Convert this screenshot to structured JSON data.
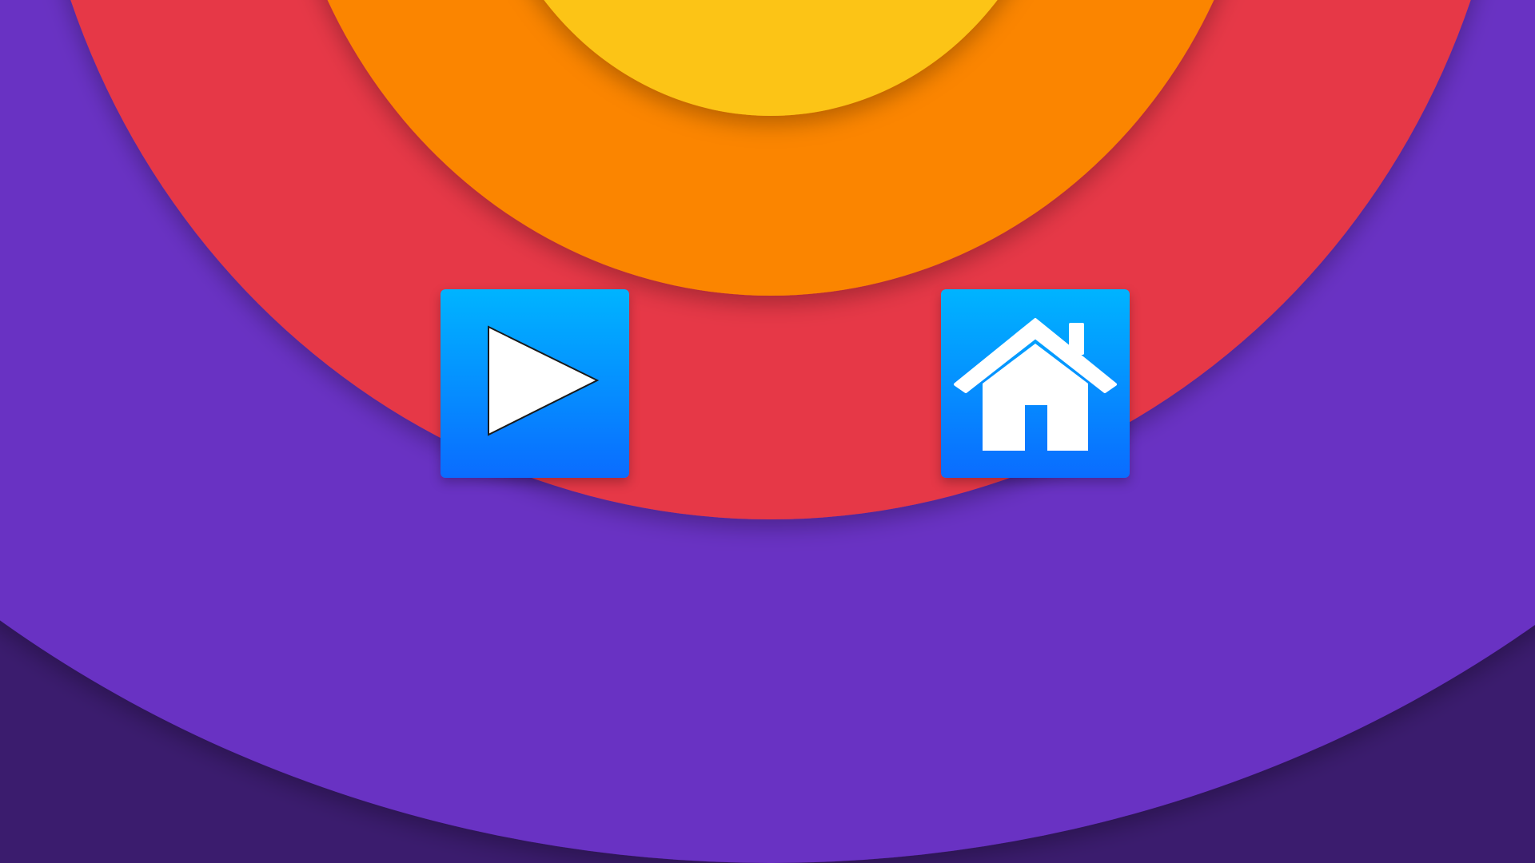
{
  "background": {
    "rings": [
      {
        "name": "outer-dark",
        "color": "#3b1c6e"
      },
      {
        "name": "purple",
        "color": "#6930c3"
      },
      {
        "name": "red",
        "color": "#e63946"
      },
      {
        "name": "orange",
        "color": "#fb8500"
      },
      {
        "name": "yellow",
        "color": "#fcc419"
      }
    ]
  },
  "buttons": {
    "play": {
      "icon": "play-icon",
      "gradient_top": "#00b4ff",
      "gradient_bottom": "#0a6cff"
    },
    "home": {
      "icon": "home-icon",
      "gradient_top": "#00b4ff",
      "gradient_bottom": "#0a6cff"
    }
  }
}
